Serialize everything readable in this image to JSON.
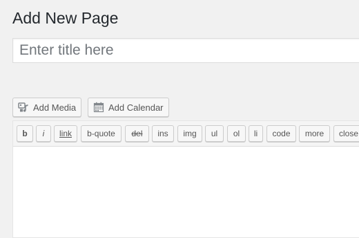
{
  "page": {
    "title": "Add New Page"
  },
  "title_field": {
    "placeholder": "Enter title here",
    "value": ""
  },
  "media_buttons": {
    "add_media": {
      "label": "Add Media",
      "icon": "media-icon"
    },
    "add_calendar": {
      "label": "Add Calendar",
      "icon": "calendar-icon"
    }
  },
  "quicktags": [
    {
      "label": "b",
      "name": "qt-bold-button"
    },
    {
      "label": "i",
      "name": "qt-italic-button"
    },
    {
      "label": "link",
      "name": "qt-link-button"
    },
    {
      "label": "b-quote",
      "name": "qt-blockquote-button"
    },
    {
      "label": "del",
      "name": "qt-del-button"
    },
    {
      "label": "ins",
      "name": "qt-ins-button"
    },
    {
      "label": "img",
      "name": "qt-img-button"
    },
    {
      "label": "ul",
      "name": "qt-ul-button"
    },
    {
      "label": "ol",
      "name": "qt-ol-button"
    },
    {
      "label": "li",
      "name": "qt-li-button"
    },
    {
      "label": "code",
      "name": "qt-code-button"
    },
    {
      "label": "more",
      "name": "qt-more-button"
    },
    {
      "label": "close",
      "name": "qt-close-tags-button"
    }
  ],
  "editor": {
    "content": ""
  }
}
